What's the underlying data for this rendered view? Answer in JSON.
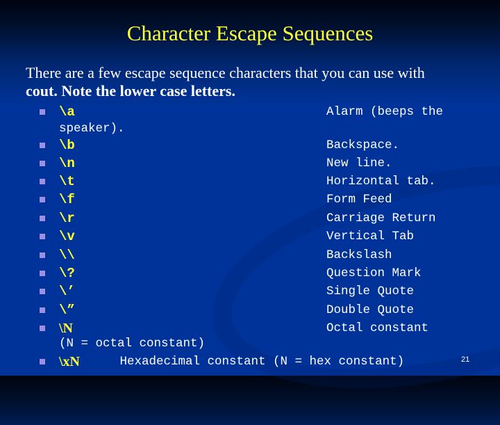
{
  "slide": {
    "title": "Character Escape Sequences",
    "intro_line1": "There are a few escape sequence characters that you can use with",
    "intro_line2_bold": "cout.  Note the lower case letters.",
    "items": [
      {
        "code": "\\a",
        "description": "Alarm (beeps the",
        "continuation": "speaker)."
      },
      {
        "code": "\\b",
        "description": "Backspace."
      },
      {
        "code": "\\n",
        "description": "New line."
      },
      {
        "code": "\\t",
        "description": "Horizontal tab."
      },
      {
        "code": "\\f",
        "description": "Form Feed"
      },
      {
        "code": "\\r",
        "description": "Carriage Return"
      },
      {
        "code": "\\v",
        "description": "Vertical Tab"
      },
      {
        "code": "\\\\",
        "description": "Backslash"
      },
      {
        "code": "\\?",
        "description": "Question Mark"
      },
      {
        "code": "\\’",
        "description": "Single Quote"
      },
      {
        "code": "\\”",
        "description": "Double Quote"
      },
      {
        "code": "\\N",
        "description": "Octal constant",
        "continuation": "(N = octal constant)"
      },
      {
        "code": "\\xN",
        "description": "     Hexadecimal constant (N = hex constant)"
      }
    ],
    "page_number": "21"
  },
  "colors": {
    "title": "#ffff33",
    "code": "#ffff33",
    "text": "#ffffff",
    "bullet": "#9f8fe0",
    "background": "#003399"
  }
}
